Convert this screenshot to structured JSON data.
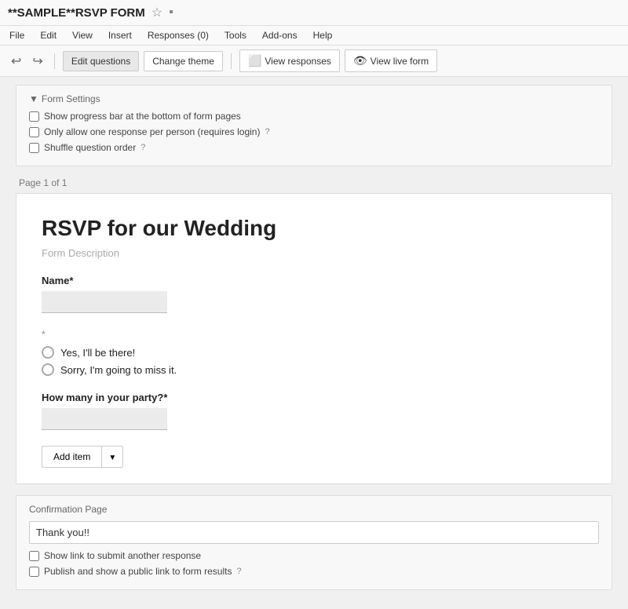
{
  "titleBar": {
    "title": "**SAMPLE**RSVP FORM",
    "star": "☆",
    "folder": "▪"
  },
  "menuBar": {
    "items": [
      "File",
      "Edit",
      "View",
      "Insert",
      "Responses (0)",
      "Tools",
      "Add-ons",
      "Help"
    ]
  },
  "toolbar": {
    "undo_icon": "↩",
    "redo_icon": "↪",
    "edit_questions_label": "Edit questions",
    "change_theme_label": "Change theme",
    "view_responses_icon": "⬜",
    "view_responses_label": "View responses",
    "view_live_icon": "👁",
    "view_live_label": "View live form"
  },
  "formSettings": {
    "section_title": "Form Settings",
    "options": [
      {
        "label": "Show progress bar at the bottom of form pages",
        "checked": false
      },
      {
        "label": "Only allow one response per person (requires login)",
        "checked": false,
        "has_help": true
      },
      {
        "label": "Shuffle question order",
        "checked": false,
        "has_help": true
      }
    ]
  },
  "pageIndicator": "Page 1 of 1",
  "form": {
    "title": "RSVP for our Wedding",
    "description": "Form Description",
    "fields": [
      {
        "type": "text",
        "label": "Name",
        "required": true
      },
      {
        "type": "radio",
        "label": "*",
        "options": [
          "Yes, I'll be there!",
          "Sorry, I'm going to miss it."
        ]
      },
      {
        "type": "text",
        "label": "How many in your party?",
        "required": true
      }
    ],
    "add_item_label": "Add item"
  },
  "confirmationPage": {
    "title": "Confirmation Page",
    "thank_you_text": "Thank you!!",
    "options": [
      {
        "label": "Show link to submit another response",
        "checked": false
      },
      {
        "label": "Publish and show a public link to form results",
        "checked": false,
        "has_help": true
      }
    ]
  }
}
